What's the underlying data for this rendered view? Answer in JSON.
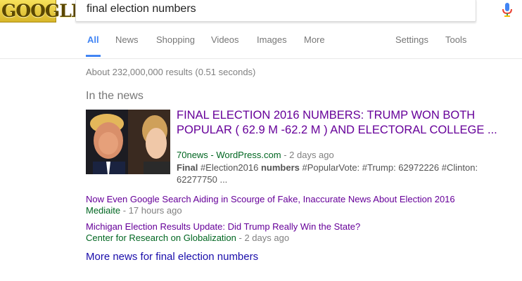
{
  "logo": {
    "text": "GOOGLE"
  },
  "search": {
    "query": "final election numbers"
  },
  "tabs": [
    {
      "label": "All",
      "active": true
    },
    {
      "label": "News"
    },
    {
      "label": "Shopping"
    },
    {
      "label": "Videos"
    },
    {
      "label": "Images"
    },
    {
      "label": "More"
    },
    {
      "label": "Settings"
    },
    {
      "label": "Tools"
    }
  ],
  "result_stats": "About 232,000,000 results (0.51 seconds)",
  "news": {
    "heading": "In the news",
    "top_story": {
      "title": "FINAL ELECTION 2016 NUMBERS: TRUMP WON BOTH POPULAR ( 62.9 M -62.2 M ) AND ELECTORAL COLLEGE ...",
      "source": "70news - WordPress.com",
      "time": " - 2 days ago",
      "snippet_b1": "Final",
      "snippet_t1": " #Election2016 ",
      "snippet_b2": "numbers",
      "snippet_t2": " #PopularVote: #Trump: 62972226 #Clinton: 62277750 ..."
    },
    "items": [
      {
        "title": "Now Even Google Search Aiding in Scourge of Fake, Inaccurate News About Election 2016",
        "source": "Mediaite",
        "time": " - 17 hours ago"
      },
      {
        "title": "Michigan Election Results Update: Did Trump Really Win the State?",
        "source": "Center for Research on Globalization",
        "time": " - 2 days ago"
      }
    ],
    "more_link": "More news for final election numbers"
  },
  "colors": {
    "accent": "#4285f4",
    "visited_link": "#660099",
    "link": "#1a0dab",
    "url_green": "#006621"
  },
  "icons": [
    "mic-icon",
    "search-icon"
  ]
}
